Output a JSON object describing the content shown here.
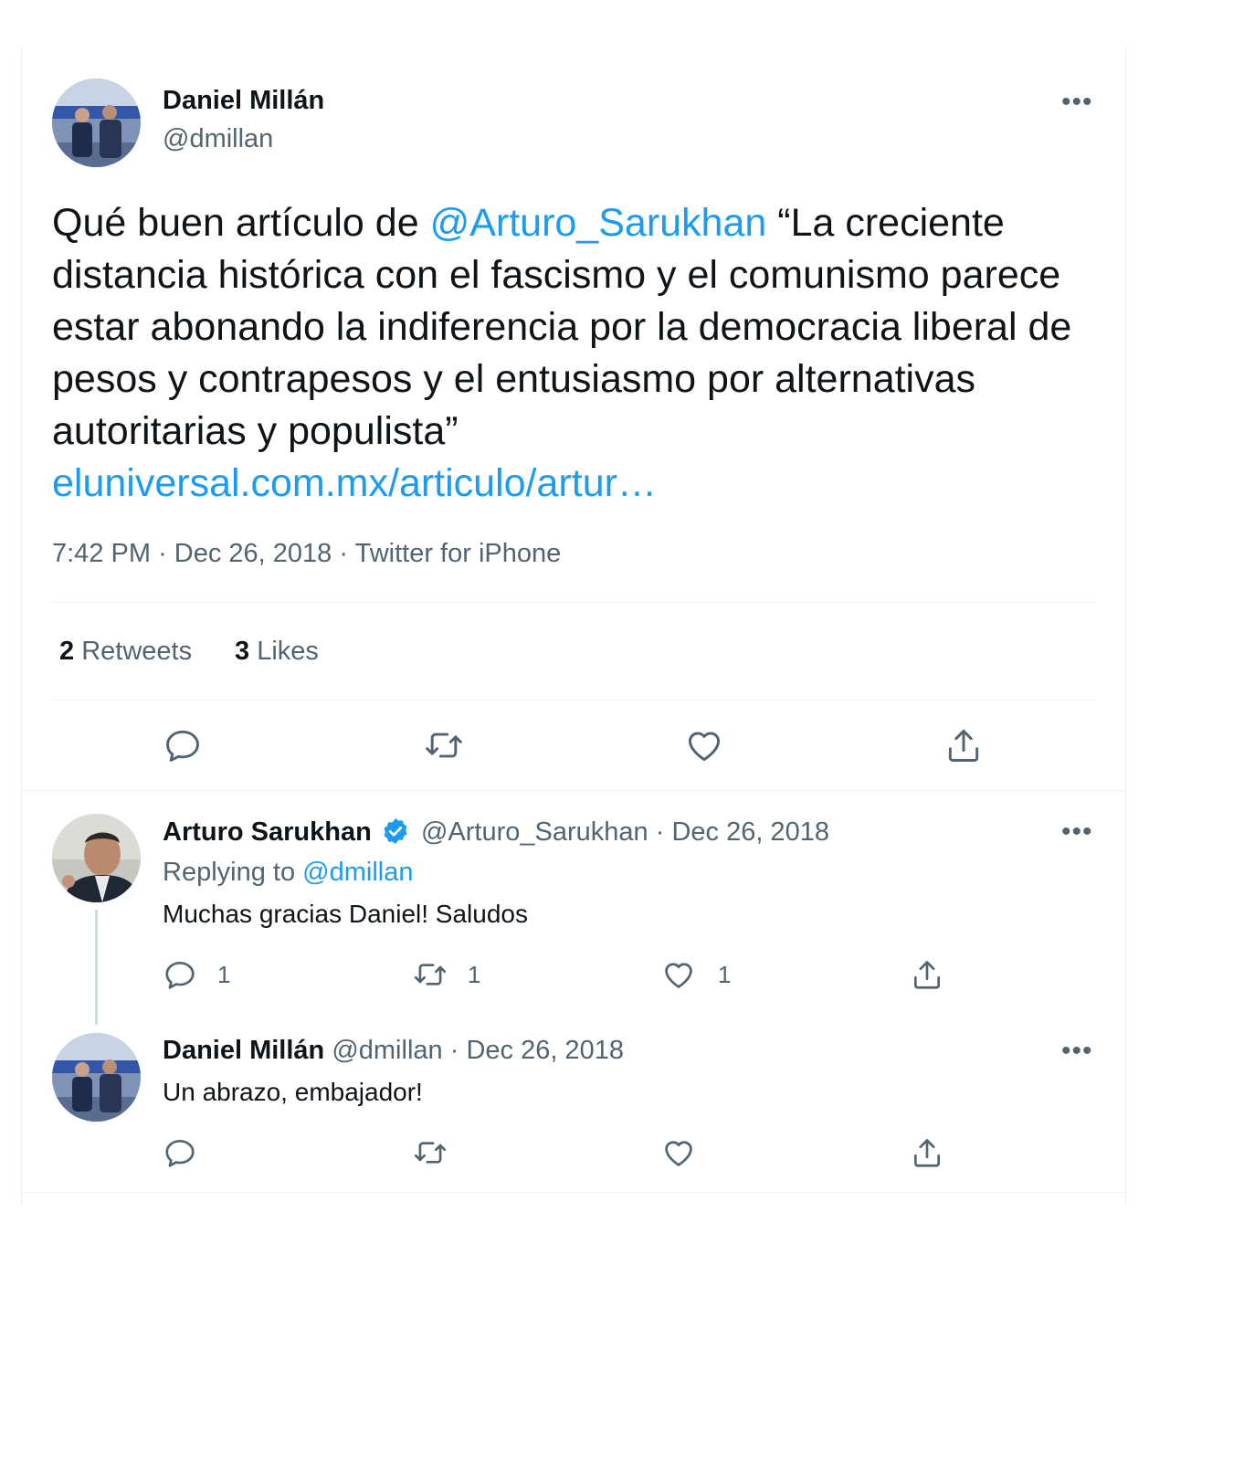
{
  "main_tweet": {
    "author_name": "Daniel Millán",
    "author_handle": "@dmillan",
    "more_label": "•••",
    "text_before": "Qué buen artículo de ",
    "mention": "@Arturo_Sarukhan",
    "text_after": " “La creciente distancia histórica con el fascismo y el comunismo parece estar abonando la indiferencia por la democracia liberal de pesos y contrapesos y el entusiasmo por alternativas autoritarias y populista”",
    "link_text": "eluniversal.com.mx/articulo/artur…",
    "timestamp": "7:42 PM",
    "date": "Dec 26, 2018",
    "source": "Twitter for iPhone",
    "separator": "·",
    "retweets_count": "2",
    "retweets_label": "Retweets",
    "likes_count": "3",
    "likes_label": "Likes"
  },
  "replies": [
    {
      "author_name": "Arturo Sarukhan",
      "verified": true,
      "author_handle": "@Arturo_Sarukhan",
      "date": "Dec 26, 2018",
      "replying_prefix": "Replying to",
      "replying_to": "@dmillan",
      "text": "Muchas gracias Daniel! Saludos",
      "reply_count": "1",
      "retweet_count": "1",
      "like_count": "1"
    },
    {
      "author_name": "Daniel Millán",
      "author_handle": "@dmillan",
      "date": "Dec 26, 2018",
      "text": "Un abrazo, embajador!"
    }
  ],
  "icons": [
    "reply-icon",
    "retweet-icon",
    "like-icon",
    "share-icon",
    "more-icon",
    "verified-badge-icon"
  ],
  "colors": {
    "link": "#1d9bf0",
    "secondary_text": "#536471",
    "primary_text": "#0f1419",
    "divider": "#eff3f4",
    "thread_line": "#cfd9de"
  }
}
